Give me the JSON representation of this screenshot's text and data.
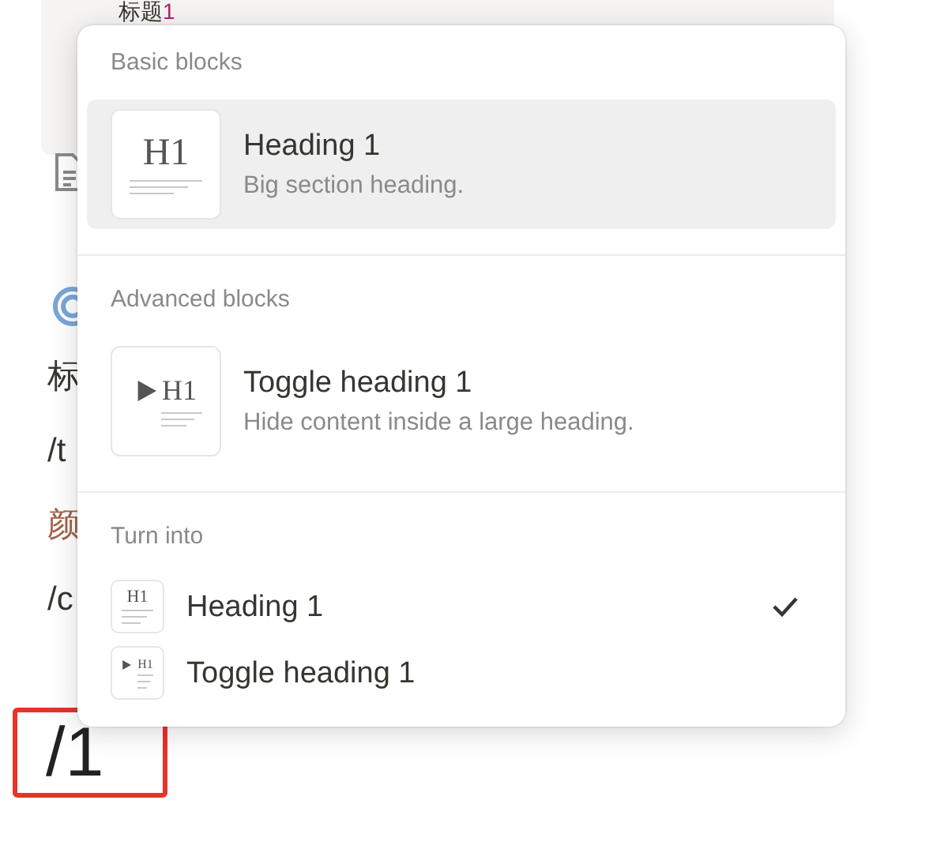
{
  "page": {
    "top_block": {
      "text": "标题",
      "number": "1"
    },
    "lines": [
      {
        "kind": "plain",
        "text": "标"
      },
      {
        "kind": "plain",
        "text": "/t"
      },
      {
        "kind": "colored",
        "text": "颜"
      },
      {
        "kind": "plain",
        "text": "/c"
      }
    ],
    "typed": "/1"
  },
  "menu": {
    "sections": [
      {
        "title": "Basic blocks",
        "kind": "blocks",
        "items": [
          {
            "kind": "heading",
            "icon_text": "H1",
            "title": "Heading 1",
            "description": "Big section heading.",
            "selected": true
          }
        ]
      },
      {
        "title": "Advanced blocks",
        "kind": "blocks",
        "items": [
          {
            "kind": "toggle",
            "icon_text": "H1",
            "title": "Toggle heading 1",
            "description": "Hide content inside a large heading.",
            "selected": false
          }
        ]
      },
      {
        "title": "Turn into",
        "kind": "turn_into",
        "items": [
          {
            "kind": "heading",
            "icon_text": "H1",
            "title": "Heading 1",
            "checked": true,
            "selected": false
          },
          {
            "kind": "toggle",
            "icon_text": "H1",
            "title": "Toggle heading 1",
            "checked": false,
            "selected": false
          }
        ]
      }
    ]
  }
}
